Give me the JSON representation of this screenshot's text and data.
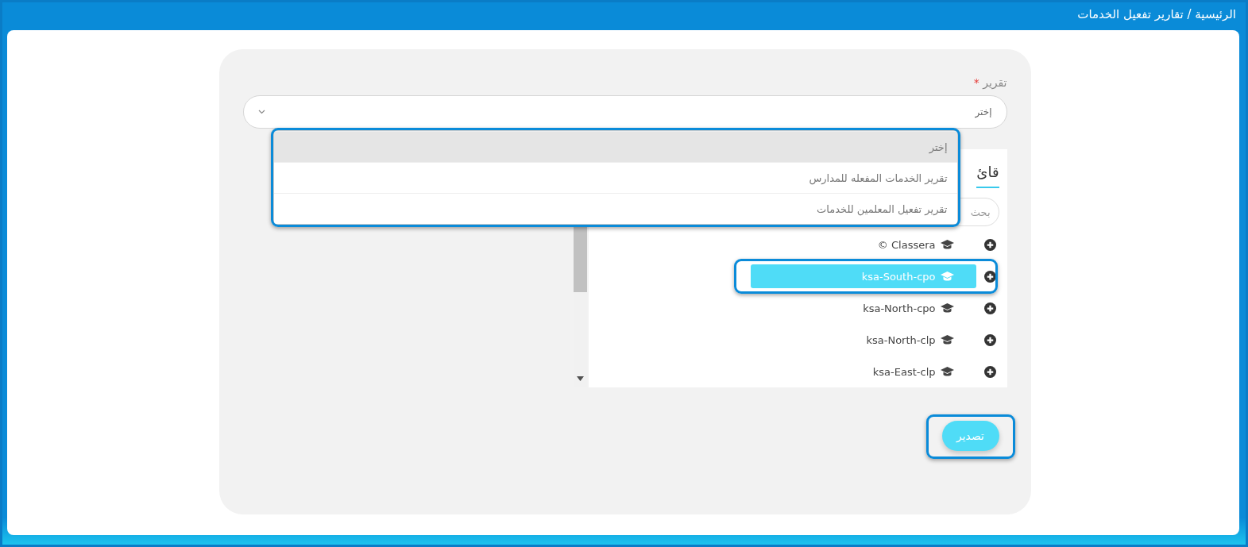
{
  "breadcrumb": "الرئيسية / تقارير تفعيل الخدمات",
  "form": {
    "label": "تقرير",
    "required_mark": "*",
    "select": {
      "value": "إختر",
      "expanded": true,
      "highlighted": true,
      "options": [
        {
          "label": "إختر",
          "selected": true
        },
        {
          "label": "تقرير الخدمات المفعله للمدارس",
          "selected": false
        },
        {
          "label": "تقرير تفعيل المعلمين للخدمات",
          "selected": false
        }
      ]
    }
  },
  "panel": {
    "tab": {
      "label": "قائ",
      "selected": true
    },
    "search": {
      "placeholder": "بحث"
    },
    "tree": [
      {
        "label": "Classera ©",
        "selected": false,
        "highlighted": false
      },
      {
        "label": "ksa-South-cpo",
        "selected": true,
        "highlighted": true
      },
      {
        "label": "ksa-North-cpo",
        "selected": false,
        "highlighted": false
      },
      {
        "label": "ksa-North-clp",
        "selected": false,
        "highlighted": false
      },
      {
        "label": "ksa-East-clp",
        "selected": false,
        "highlighted": false
      }
    ]
  },
  "export_button": {
    "label": "تصدير",
    "highlighted": true
  }
}
